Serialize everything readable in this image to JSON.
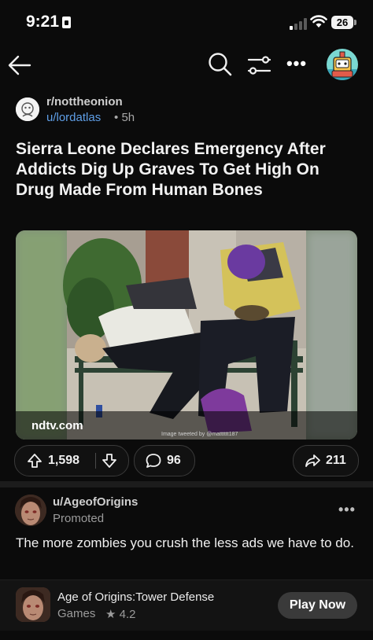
{
  "status_bar": {
    "time": "9:21",
    "battery": "26"
  },
  "post": {
    "subreddit": "r/nottheonion",
    "author": "u/lordatlas",
    "age": "5h",
    "separator": "•",
    "title": "Sierra Leone Declares Emergency After Addicts Dig Up Graves To Get High On Drug Made From Human Bones",
    "link_domain": "ndtv.com",
    "image_credit": "Image tweeted by @matttttt187",
    "upvotes": "1,598",
    "comments": "96",
    "shares": "211"
  },
  "ad": {
    "advertiser": "u/AgeofOrigins",
    "promoted_label": "Promoted",
    "text": "The more zombies you crush the less ads we have to do.",
    "app_name": "Age of Origins:Tower Defense",
    "app_category": "Games",
    "app_rating": "4.2",
    "cta": "Play Now"
  },
  "icons": [
    "back-arrow-icon",
    "search-icon",
    "filter-icon",
    "more-icon",
    "avatar-icon",
    "upvote-icon",
    "downvote-icon",
    "comment-icon",
    "share-icon",
    "star-icon"
  ]
}
